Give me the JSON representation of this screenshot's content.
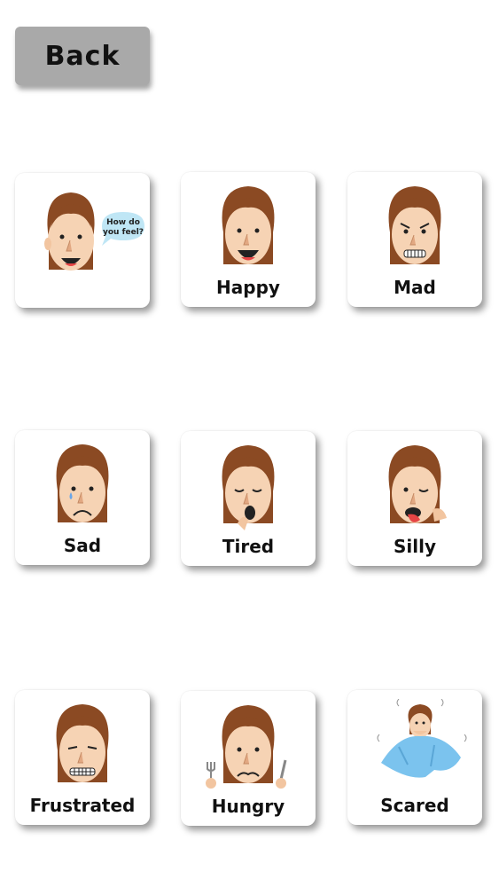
{
  "back_label": "Back",
  "bubble_text": [
    "How do",
    "you feel?"
  ],
  "emotions": [
    {
      "label": ""
    },
    {
      "label": "Happy"
    },
    {
      "label": "Mad"
    },
    {
      "label": "Sad"
    },
    {
      "label": "Tired"
    },
    {
      "label": "Silly"
    },
    {
      "label": "Frustrated"
    },
    {
      "label": "Hungry"
    },
    {
      "label": "Scared"
    }
  ]
}
